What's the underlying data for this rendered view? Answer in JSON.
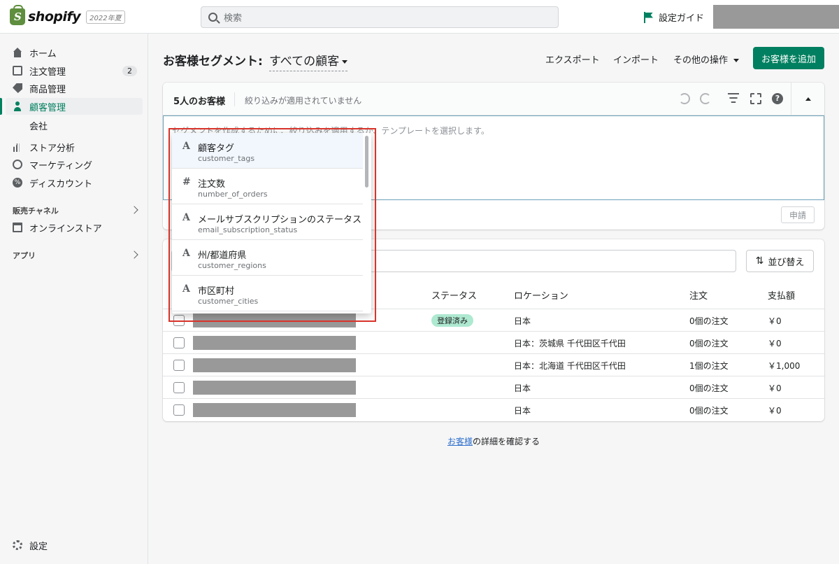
{
  "topbar": {
    "logo_text": "shopify",
    "logo_badge": "2022年夏",
    "search_placeholder": "検索",
    "guide_label": "設定ガイド"
  },
  "sidebar": {
    "items": [
      {
        "label": "ホーム",
        "icon": "home-icon"
      },
      {
        "label": "注文管理",
        "icon": "inbox-icon",
        "badge": "2"
      },
      {
        "label": "商品管理",
        "icon": "tag-icon"
      },
      {
        "label": "顧客管理",
        "icon": "person-icon",
        "active": true
      },
      {
        "label": "ストア分析",
        "icon": "bar-chart-icon"
      },
      {
        "label": "マーケティング",
        "icon": "target-icon"
      },
      {
        "label": "ディスカウント",
        "icon": "discount-icon"
      }
    ],
    "sub_item": "会社",
    "sales_channels_label": "販売チャネル",
    "online_store_label": "オンラインストア",
    "apps_label": "アプリ",
    "settings_label": "設定"
  },
  "header": {
    "title": "お客様セグメント:",
    "segment": "すべての顧客",
    "export_label": "エクスポート",
    "import_label": "インポート",
    "more_actions_label": "その他の操作",
    "add_customer_label": "お客様を追加"
  },
  "filter": {
    "count_label": "5人のお客様",
    "note": "絞り込みが適用されていません",
    "editor_placeholder": "セグメントを作成するために、絞り込みを適用するか、テンプレートを選択します。",
    "apply_label": "申請"
  },
  "dropdown": {
    "items": [
      {
        "type": "A",
        "label": "顧客タグ",
        "key": "customer_tags"
      },
      {
        "type": "#",
        "label": "注文数",
        "key": "number_of_orders"
      },
      {
        "type": "A",
        "label": "メールサブスクリプションのステータス",
        "key": "email_subscription_status"
      },
      {
        "type": "A",
        "label": "州/都道府県",
        "key": "customer_regions"
      },
      {
        "type": "A",
        "label": "市区町村",
        "key": "customer_cities"
      }
    ]
  },
  "table": {
    "sort_label": "並び替え",
    "columns": {
      "status": "ステータス",
      "location": "ロケーション",
      "orders": "注文",
      "spent": "支払額"
    },
    "rows": [
      {
        "status": "登録済み",
        "location": "日本",
        "orders": "0個の注文",
        "spent": "￥0"
      },
      {
        "status": "",
        "location": "日本：茨城県 千代田区千代田",
        "orders": "0個の注文",
        "spent": "￥0"
      },
      {
        "status": "",
        "location": "日本：北海道 千代田区千代田",
        "orders": "1個の注文",
        "spent": "￥1,000"
      },
      {
        "status": "",
        "location": "日本",
        "orders": "0個の注文",
        "spent": "￥0"
      },
      {
        "status": "",
        "location": "日本",
        "orders": "0個の注文",
        "spent": "￥0"
      }
    ]
  },
  "footer": {
    "link_text": "お客様",
    "rest_text": "の詳細を確認する"
  },
  "colors": {
    "primary": "#008060",
    "highlight": "#d9342b",
    "status_badge": "#aee9d1"
  }
}
